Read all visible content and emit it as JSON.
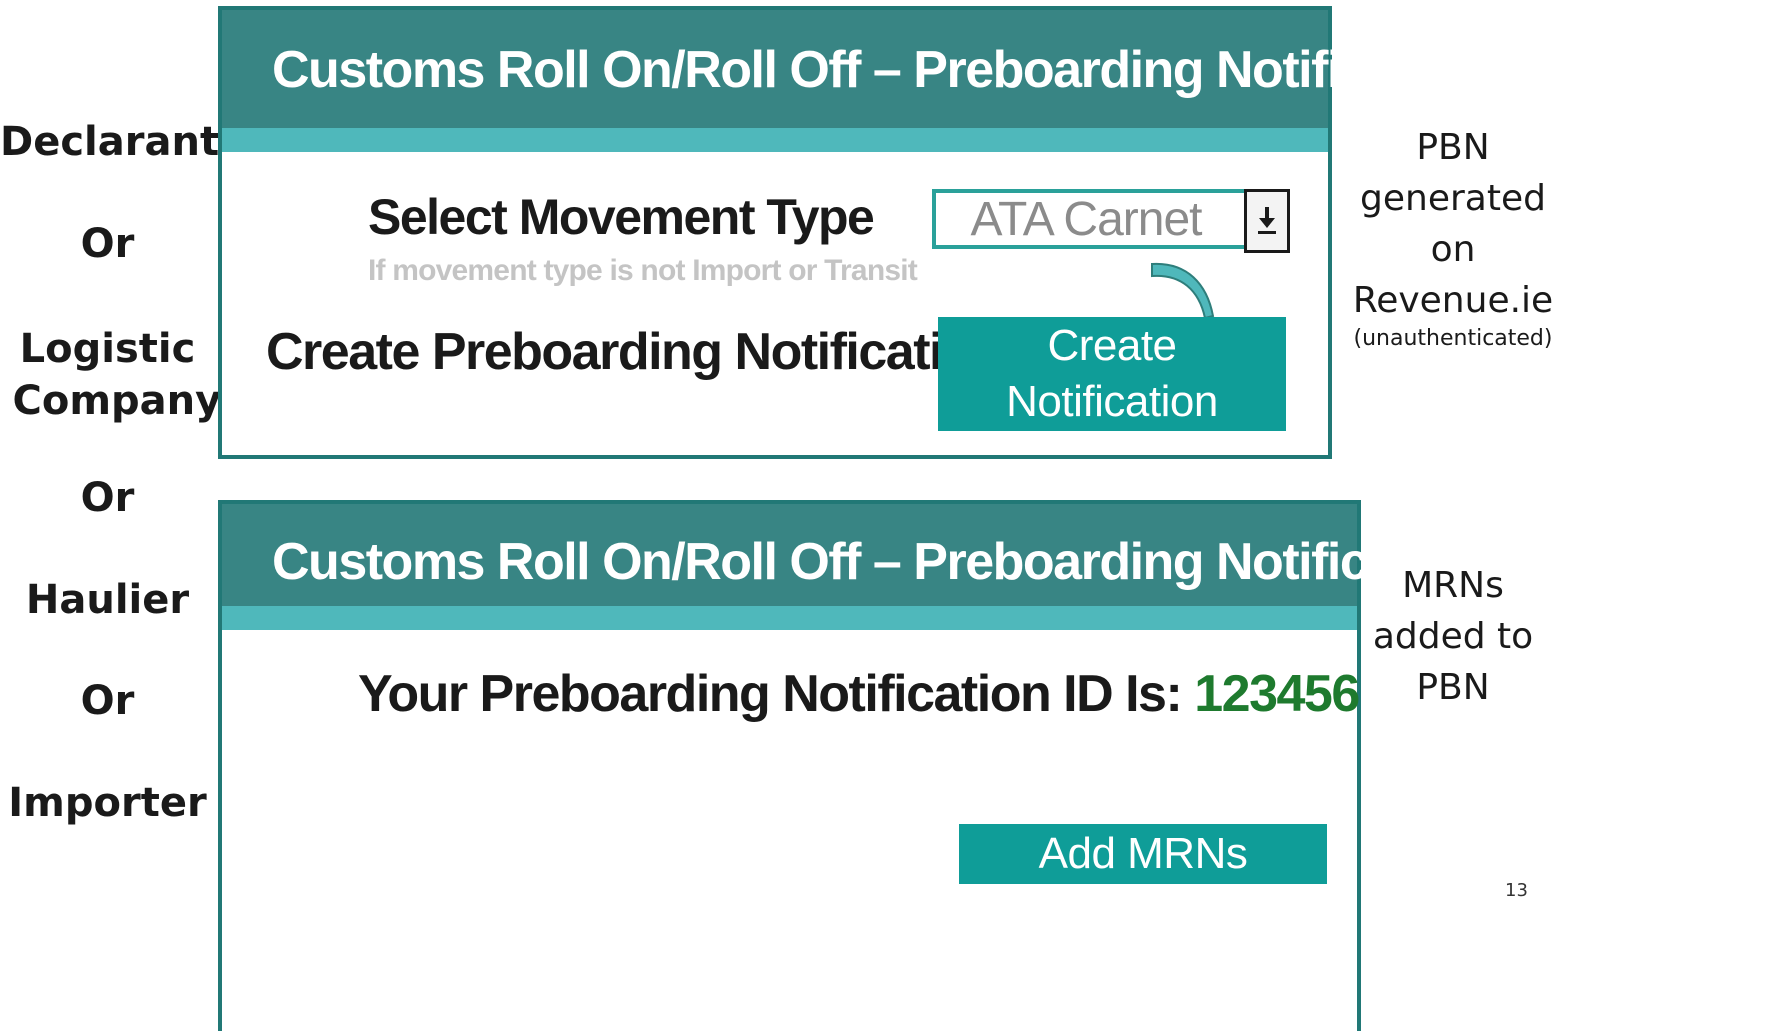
{
  "roles": [
    "Declarant",
    "Or",
    "Logistic Company",
    "Or",
    "Haulier",
    "Or",
    "Importer"
  ],
  "panel1": {
    "title": "Customs Roll On/Roll Off – Preboarding Notification",
    "select_movement_label": "Select Movement Type",
    "select_hint": "If movement type is not Import or Transit",
    "movement_type_value": "ATA Carnet",
    "dropdown_icon": "download-arrow-icon",
    "create_label": "Create Preboarding Notification",
    "create_button_line1": "Create",
    "create_button_line2": "Notification"
  },
  "panel2": {
    "title": "Customs Roll On/Roll Off – Preboarding Notification",
    "id_label": "Your Preboarding Notification ID Is:",
    "id_value": "123456",
    "add_mrns_button": "Add MRNs"
  },
  "side_notes": {
    "pbn_line1": "PBN",
    "pbn_line2": "generated",
    "pbn_line3": "on",
    "pbn_line4": "Revenue.ie",
    "pbn_line5": "(unauthenticated)",
    "mrn_line1": "MRNs",
    "mrn_line2": "added to",
    "mrn_line3": "PBN"
  },
  "page_number": "13",
  "colors": {
    "header_teal": "#388584",
    "strip_teal": "#4fb8bb",
    "button_teal": "#0f9d98",
    "border_teal": "#217876",
    "id_green": "#1e7a2e"
  }
}
